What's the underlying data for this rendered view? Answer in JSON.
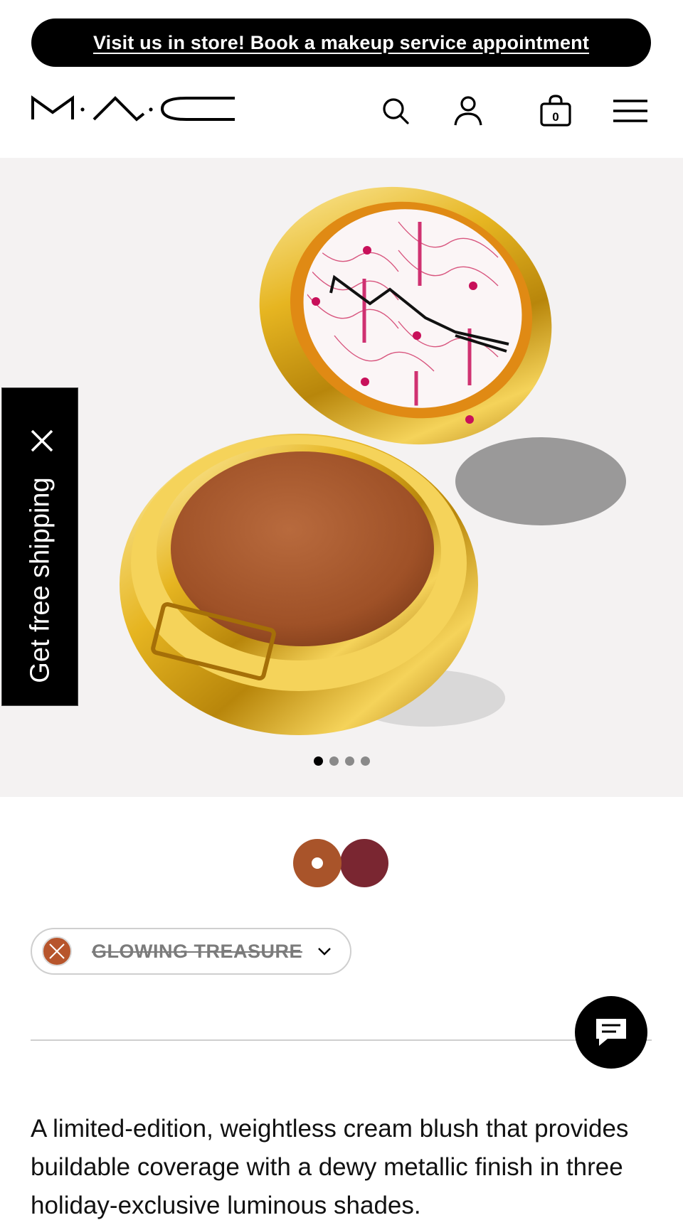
{
  "promo": {
    "text": "Visit us in store! Book a makeup service appointment"
  },
  "header": {
    "logo": "M·A·C",
    "icons": [
      "search-icon",
      "account-icon",
      "bag-icon",
      "menu-icon"
    ],
    "bag_count": "0"
  },
  "hero": {
    "carousel_total": 4,
    "carousel_active": 1
  },
  "free_shipping": {
    "label": "Get free shipping"
  },
  "swatches": [
    {
      "color": "#a9542a",
      "selected": true
    },
    {
      "color": "#7a2631",
      "selected": false
    }
  ],
  "shade": {
    "name": "GLOWING TREASURE",
    "color": "#b7552c",
    "status": "unavailable"
  },
  "description": "A limited-edition, weightless cream blush that provides buildable coverage with a dewy metallic finish in three holiday-exclusive luminous shades."
}
